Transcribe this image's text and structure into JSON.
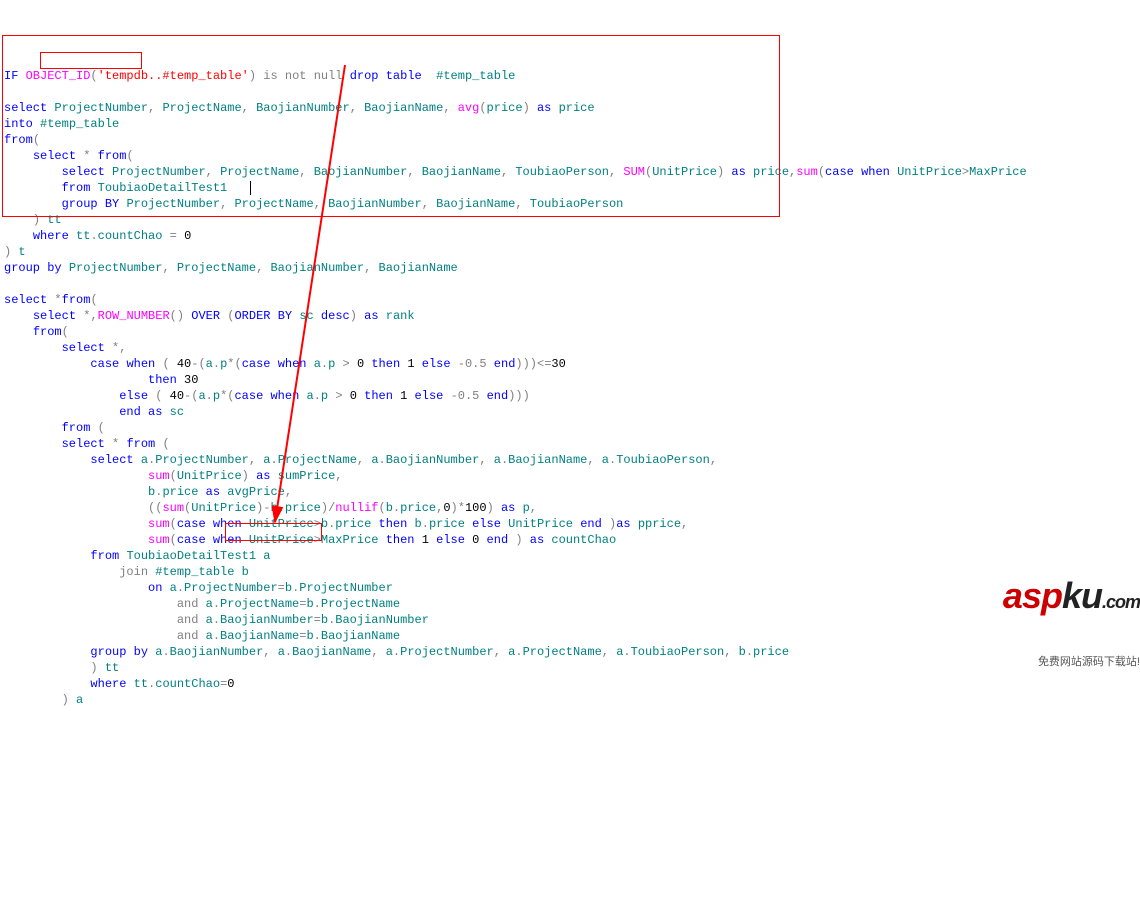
{
  "code": {
    "line1": {
      "t1": "IF",
      "t2": "OBJECT_ID",
      "t3": "(",
      "t4": "'tempdb..#temp_table'",
      "t5": ")",
      "t6": "is",
      "t7": "not",
      "t8": "null",
      "t9": "drop",
      "t10": "table",
      "t11": "#temp_table"
    },
    "line3": {
      "t1": "select",
      "t2": "ProjectNumber",
      "t3": ",",
      "t4": "ProjectName",
      "t5": ",",
      "t6": "BaojianNumber",
      "t7": ",",
      "t8": "BaojianName",
      "t9": ",",
      "t10": "avg",
      "t11": "(",
      "t12": "price",
      "t13": ")",
      "t14": "as",
      "t15": "price"
    },
    "line4": {
      "t1": "into",
      "t2": "#temp_table"
    },
    "line5": {
      "t1": "from",
      "t2": "("
    },
    "line6": {
      "t1": "select",
      "t2": "*",
      "t3": "from",
      "t4": "("
    },
    "line7": {
      "t1": "select",
      "t2": "ProjectNumber",
      "t3": ",",
      "t4": "ProjectName",
      "t5": ",",
      "t6": "BaojianNumber",
      "t7": ",",
      "t8": "BaojianName",
      "t9": ",",
      "t10": "ToubiaoPerson",
      "t11": ",",
      "t12": "SUM",
      "t13": "(",
      "t14": "UnitPrice",
      "t15": ")",
      "t16": "as",
      "t17": "price",
      "t18": ",",
      "t19": "sum",
      "t20": "(",
      "t21": "case",
      "t22": "when",
      "t23": "UnitPrice",
      "t24": ">",
      "t25": "MaxPrice"
    },
    "line8": {
      "t1": "from",
      "t2": "ToubiaoDetailTest1"
    },
    "line9": {
      "t1": "group",
      "t2": "BY",
      "t3": "ProjectNumber",
      "t4": ",",
      "t5": "ProjectName",
      "t6": ",",
      "t7": "BaojianNumber",
      "t8": ",",
      "t9": "BaojianName",
      "t10": ",",
      "t11": "ToubiaoPerson"
    },
    "line10": {
      "t1": ")",
      "t2": "tt"
    },
    "line11": {
      "t1": "where",
      "t2": "tt",
      "t3": ".",
      "t4": "countChao",
      "t5": "=",
      "t6": "0"
    },
    "line12": {
      "t1": ")",
      "t2": "t"
    },
    "line13": {
      "t1": "group",
      "t2": "by",
      "t3": "ProjectNumber",
      "t4": ",",
      "t5": "ProjectName",
      "t6": ",",
      "t7": "BaojianNumber",
      "t8": ",",
      "t9": "BaojianName"
    },
    "line15": {
      "t1": "select",
      "t2": "*",
      "t3": "from",
      "t4": "("
    },
    "line16": {
      "t1": "select",
      "t2": "*",
      "t3": ",",
      "t4": "ROW_NUMBER",
      "t5": "()",
      "t6": "OVER",
      "t7": "(",
      "t8": "ORDER",
      "t9": "BY",
      "t10": "sc",
      "t11": "desc",
      "t12": ")",
      "t13": "as",
      "t14": "rank"
    },
    "line17": {
      "t1": "from",
      "t2": "("
    },
    "line18": {
      "t1": "select",
      "t2": "*",
      "t3": ","
    },
    "line19": {
      "t1": "case",
      "t2": "when",
      "t3": "(",
      "t4": "40",
      "t5": "-(",
      "t6": "a",
      "t7": ".",
      "t8": "p",
      "t9": "*(",
      "t10": "case",
      "t11": "when",
      "t12": "a",
      "t13": ".",
      "t14": "p",
      "t15": ">",
      "t16": "0",
      "t17": "then",
      "t18": "1",
      "t19": "else",
      "t20": "-0.5",
      "t21": "end",
      "t22": ")))<=",
      "t23": "30"
    },
    "line20": {
      "t1": "then",
      "t2": "30"
    },
    "line21": {
      "t1": "else",
      "t2": "(",
      "t3": "40",
      "t4": "-(",
      "t5": "a",
      "t6": ".",
      "t7": "p",
      "t8": "*(",
      "t9": "case",
      "t10": "when",
      "t11": "a",
      "t12": ".",
      "t13": "p",
      "t14": ">",
      "t15": "0",
      "t16": "then",
      "t17": "1",
      "t18": "else",
      "t19": "-0.5",
      "t20": "end",
      "t21": ")))"
    },
    "line22": {
      "t1": "end",
      "t2": "as",
      "t3": "sc"
    },
    "line23": {
      "t1": "from",
      "t2": "("
    },
    "line24": {
      "t1": "select",
      "t2": "*",
      "t3": "from",
      "t4": "("
    },
    "line25": {
      "t1": "select",
      "t2": "a",
      "t3": ".",
      "t4": "ProjectNumber",
      "t5": ",",
      "t6": "a",
      "t7": ".",
      "t8": "ProjectName",
      "t9": ",",
      "t10": "a",
      "t11": ".",
      "t12": "BaojianNumber",
      "t13": ",",
      "t14": "a",
      "t15": ".",
      "t16": "BaojianName",
      "t17": ",",
      "t18": "a",
      "t19": ".",
      "t20": "ToubiaoPerson",
      "t21": ","
    },
    "line26": {
      "t1": "sum",
      "t2": "(",
      "t3": "UnitPrice",
      "t4": ")",
      "t5": "as",
      "t6": "sumPrice",
      "t7": ","
    },
    "line27": {
      "t1": "b",
      "t2": ".",
      "t3": "price",
      "t4": "as",
      "t5": "avgPrice",
      "t6": ","
    },
    "line28": {
      "t1": "((",
      "t2": "sum",
      "t3": "(",
      "t4": "UnitPrice",
      "t5": ")-",
      "t6": "b",
      "t7": ".",
      "t8": "price",
      "t9": ")/",
      "t10": "nullif",
      "t11": "(",
      "t12": "b",
      "t13": ".",
      "t14": "price",
      "t15": ",",
      "t16": "0",
      "t17": ")*",
      "t18": "100",
      "t19": ")",
      "t20": "as",
      "t21": "p",
      "t22": ","
    },
    "line29": {
      "t1": "sum",
      "t2": "(",
      "t3": "case",
      "t4": "when",
      "t5": "UnitPrice",
      "t6": ">",
      "t7": "b",
      "t8": ".",
      "t9": "price",
      "t10": "then",
      "t11": "b",
      "t12": ".",
      "t13": "price",
      "t14": "else",
      "t15": "UnitPrice",
      "t16": "end",
      "t17": ")",
      "t18": "as",
      "t19": "pprice",
      "t20": ","
    },
    "line30": {
      "t1": "sum",
      "t2": "(",
      "t3": "case",
      "t4": "when",
      "t5": "UnitPrice",
      "t6": ">",
      "t7": "MaxPrice",
      "t8": "then",
      "t9": "1",
      "t10": "else",
      "t11": "0",
      "t12": "end",
      "t13": ")",
      "t14": "as",
      "t15": "countChao"
    },
    "line31": {
      "t1": "from",
      "t2": "ToubiaoDetailTest1",
      "t3": "a"
    },
    "line32": {
      "t1": "join",
      "t2": "#temp_table",
      "t3": "b"
    },
    "line33": {
      "t1": "on",
      "t2": "a",
      "t3": ".",
      "t4": "ProjectNumber",
      "t5": "=",
      "t6": "b",
      "t7": ".",
      "t8": "ProjectNumber"
    },
    "line34": {
      "t1": "and",
      "t2": "a",
      "t3": ".",
      "t4": "ProjectName",
      "t5": "=",
      "t6": "b",
      "t7": ".",
      "t8": "ProjectName"
    },
    "line35": {
      "t1": "and",
      "t2": "a",
      "t3": ".",
      "t4": "BaojianNumber",
      "t5": "=",
      "t6": "b",
      "t7": ".",
      "t8": "BaojianNumber"
    },
    "line36": {
      "t1": "and",
      "t2": "a",
      "t3": ".",
      "t4": "BaojianName",
      "t5": "=",
      "t6": "b",
      "t7": ".",
      "t8": "BaojianName"
    },
    "line37": {
      "t1": "group",
      "t2": "by",
      "t3": "a",
      "t4": ".",
      "t5": "BaojianNumber",
      "t6": ",",
      "t7": "a",
      "t8": ".",
      "t9": "BaojianName",
      "t10": ",",
      "t11": "a",
      "t12": ".",
      "t13": "ProjectNumber",
      "t14": ",",
      "t15": "a",
      "t16": ".",
      "t17": "ProjectName",
      "t18": ",",
      "t19": "a",
      "t20": ".",
      "t21": "ToubiaoPerson",
      "t22": ",",
      "t23": "b",
      "t24": ".",
      "t25": "price"
    },
    "line38": {
      "t1": ")",
      "t2": "tt"
    },
    "line39": {
      "t1": "where",
      "t2": "tt",
      "t3": ".",
      "t4": "countChao",
      "t5": "=",
      "t6": "0"
    },
    "line40": {
      "t1": ")",
      "t2": "a"
    }
  },
  "logo": {
    "asp": "asp",
    "ku": "ku",
    "com": ".com",
    "sub": "免费网站源码下载站!"
  }
}
